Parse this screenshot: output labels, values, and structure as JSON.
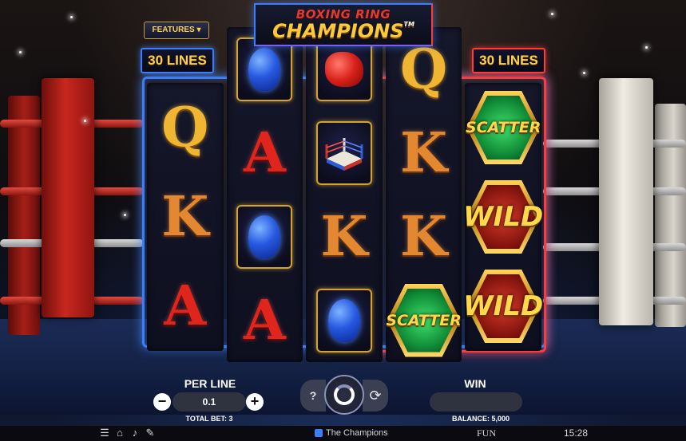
{
  "title": {
    "top": "BOXING RING",
    "main": "CHAMPIONS",
    "tm": "TM"
  },
  "features_button": "FEATURES ▾",
  "lines_left": "30 LINES",
  "lines_right": "30 LINES",
  "reels": [
    [
      "Q",
      "K",
      "A"
    ],
    [
      "pad",
      "A",
      "pad",
      "A"
    ],
    [
      "glove",
      "ring",
      "K",
      "pad"
    ],
    [
      "Q",
      "K",
      "K",
      "SCATTER"
    ],
    [
      "SCATTER",
      "WILD",
      "WILD"
    ]
  ],
  "controls": {
    "per_line_label": "PER LINE",
    "per_line_value": "0.1",
    "minus": "−",
    "plus": "+",
    "total_bet": "TOTAL BET: 3",
    "help": "?",
    "auto": "⟳",
    "win_label": "WIN",
    "balance": "BALANCE: 5,000"
  },
  "statusbar": {
    "icons": [
      "menu-icon",
      "home-icon",
      "sound-icon",
      "turbo-icon"
    ],
    "game_name": "The Champions",
    "mode": "FUN",
    "time": "15:28"
  },
  "colors": {
    "blue_frame": "#3a7dff",
    "red_frame": "#ff3a3a",
    "gold": "#ffcf45"
  }
}
